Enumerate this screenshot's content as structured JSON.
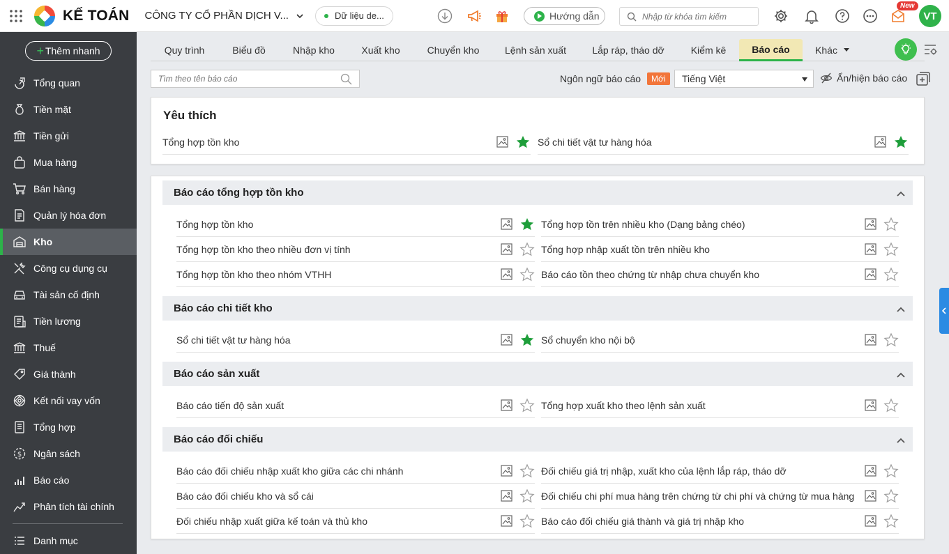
{
  "header": {
    "app_name": "KẾ TOÁN",
    "company": "CÔNG TY CỔ PHẦN DỊCH V...",
    "data_label": "Dữ liệu de...",
    "guide_label": "Hướng dẫn",
    "search_placeholder": "Nhập từ khóa tìm kiếm",
    "new_badge": "New",
    "avatar_initials": "VT",
    "brand_color": "#2db34a"
  },
  "sidebar": {
    "add_quick": "Thêm nhanh",
    "items": [
      {
        "label": "Tổng quan",
        "icon": "dashboard-icon"
      },
      {
        "label": "Tiền mặt",
        "icon": "money-bag-icon"
      },
      {
        "label": "Tiền gửi",
        "icon": "bank-icon"
      },
      {
        "label": "Mua hàng",
        "icon": "shopping-bag-icon"
      },
      {
        "label": "Bán hàng",
        "icon": "cart-icon"
      },
      {
        "label": "Quản lý hóa đơn",
        "icon": "invoice-icon"
      },
      {
        "label": "Kho",
        "icon": "warehouse-icon"
      },
      {
        "label": "Công cụ dụng cụ",
        "icon": "tools-icon"
      },
      {
        "label": "Tài sản cố định",
        "icon": "car-icon"
      },
      {
        "label": "Tiền lương",
        "icon": "payroll-icon"
      },
      {
        "label": "Thuế",
        "icon": "tax-icon"
      },
      {
        "label": "Giá thành",
        "icon": "price-tag-icon"
      },
      {
        "label": "Kết nối vay vốn",
        "icon": "loan-icon"
      },
      {
        "label": "Tổng hợp",
        "icon": "ledger-icon"
      },
      {
        "label": "Ngân sách",
        "icon": "budget-icon"
      },
      {
        "label": "Báo cáo",
        "icon": "bar-chart-icon"
      },
      {
        "label": "Phân tích tài chính",
        "icon": "analysis-icon"
      },
      {
        "label": "Danh mục",
        "icon": "list-icon"
      }
    ]
  },
  "tabs": [
    {
      "label": "Quy trình"
    },
    {
      "label": "Biểu đồ"
    },
    {
      "label": "Nhập kho"
    },
    {
      "label": "Xuất kho"
    },
    {
      "label": "Chuyển kho"
    },
    {
      "label": "Lệnh sản xuất"
    },
    {
      "label": "Lắp ráp, tháo dỡ"
    },
    {
      "label": "Kiểm kê"
    },
    {
      "label": "Báo cáo"
    },
    {
      "label": "Khác"
    }
  ],
  "filter": {
    "search_placeholder": "Tìm theo tên báo cáo",
    "language_label": "Ngôn ngữ báo cáo",
    "new_tag": "Mới",
    "language_value": "Tiếng Việt",
    "toggle_label": "Ẩn/hiện báo cáo"
  },
  "favorites": {
    "title": "Yêu thích",
    "items": [
      {
        "name": "Tổng hợp tồn kho",
        "starred": true
      },
      {
        "name": "Sổ chi tiết vật tư hàng hóa",
        "starred": true
      }
    ]
  },
  "groups": [
    {
      "title": "Báo cáo tổng hợp tồn kho",
      "items": [
        {
          "name": "Tổng hợp tồn kho",
          "starred": true
        },
        {
          "name": "Tổng hợp tồn trên nhiều kho (Dạng bảng chéo)",
          "starred": false
        },
        {
          "name": "Tổng hợp tồn kho theo nhiều đơn vị tính",
          "starred": false
        },
        {
          "name": "Tổng hợp nhập xuất tồn trên nhiều kho",
          "starred": false
        },
        {
          "name": "Tổng hợp tồn kho theo nhóm VTHH",
          "starred": false
        },
        {
          "name": "Báo cáo tồn theo chứng từ nhập chưa chuyển kho",
          "starred": false
        }
      ]
    },
    {
      "title": "Báo cáo chi tiết kho",
      "items": [
        {
          "name": "Sổ chi tiết vật tư hàng hóa",
          "starred": true
        },
        {
          "name": "Sổ chuyển kho nội bộ",
          "starred": false
        }
      ]
    },
    {
      "title": "Báo cáo sản xuất",
      "items": [
        {
          "name": "Báo cáo tiến độ sản xuất",
          "starred": false
        },
        {
          "name": "Tổng hợp xuất kho theo lệnh sản xuất",
          "starred": false
        }
      ]
    },
    {
      "title": "Báo cáo đối chiếu",
      "items": [
        {
          "name": "Báo cáo đối chiếu nhập xuất kho giữa các chi nhánh",
          "starred": false
        },
        {
          "name": "Đối chiếu giá trị nhập, xuất kho của lệnh lắp ráp, tháo dỡ",
          "starred": false
        },
        {
          "name": "Báo cáo đối chiếu kho và sổ cái",
          "starred": false
        },
        {
          "name": "Đối chiếu chi phí mua hàng trên chứng từ chi phí và chứng từ mua hàng",
          "starred": false
        },
        {
          "name": "Đối chiếu nhập xuất giữa kế toán và thủ kho",
          "starred": false
        },
        {
          "name": "Báo cáo đối chiếu giá thành và giá trị nhập kho",
          "starred": false
        }
      ]
    }
  ]
}
